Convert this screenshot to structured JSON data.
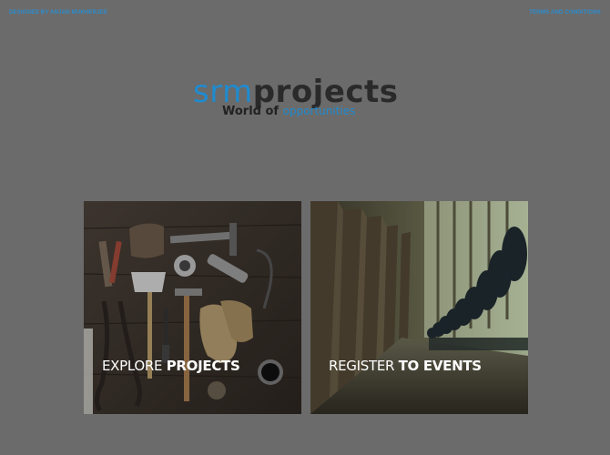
{
  "header": {
    "designer_credit": "DESIGNED BY ANJAN MUKHERJEE",
    "terms_link": "TERMS AND CONDITIONS"
  },
  "logo": {
    "part_srm": "srm",
    "part_projects": "projects",
    "tagline_plain": "World of",
    "tagline_highlight": "opportunities"
  },
  "cards": [
    {
      "label_light": "EXPLORE",
      "label_bold": "PROJECTS",
      "image": "tools-on-wooden-table"
    },
    {
      "label_light": "REGISTER",
      "label_bold": "TO EVENTS",
      "image": "auditorium-seats"
    }
  ],
  "colors": {
    "background": "#6b6b6b",
    "accent_blue": "#1f8bd0",
    "logo_dark": "#2a2a2a"
  }
}
